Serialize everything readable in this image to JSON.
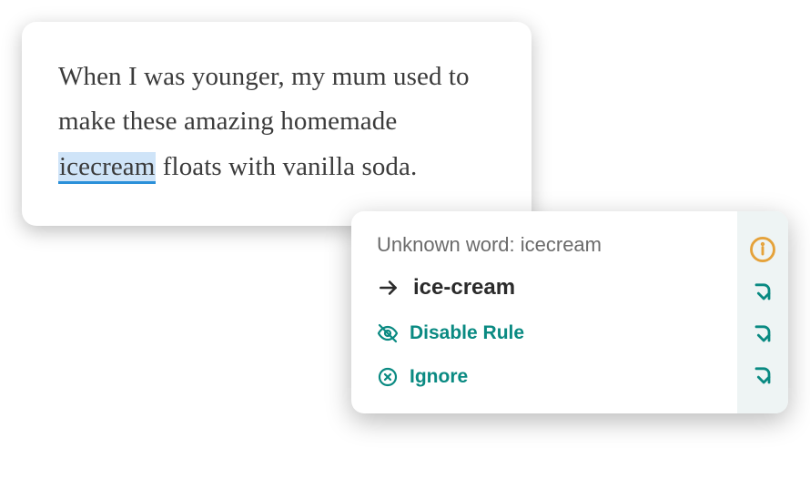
{
  "editor": {
    "before": "When I was younger, my mum used to make these amazing homemade ",
    "highlight": "icecream",
    "after": " floats with vanilla soda."
  },
  "popup": {
    "title": "Unknown word: icecream",
    "suggestion": "ice-cream",
    "disable_label": "Disable Rule",
    "ignore_label": "Ignore"
  }
}
